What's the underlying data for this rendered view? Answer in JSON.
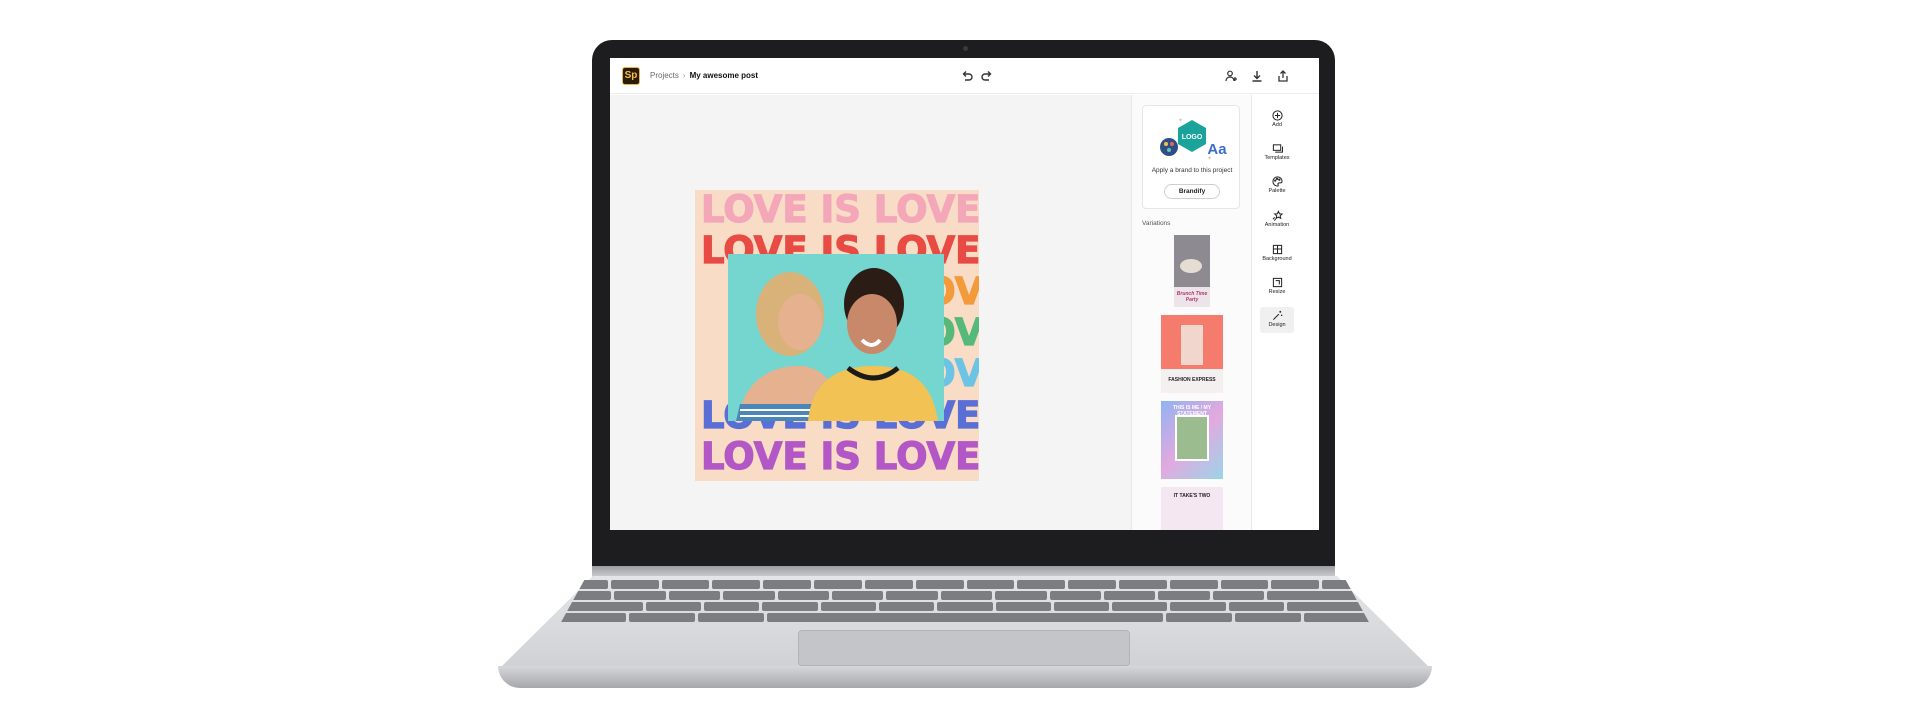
{
  "app": {
    "logo_text": "Sp",
    "breadcrumb": {
      "root": "Projects",
      "separator": "›",
      "current": "My awesome post"
    },
    "accent": "#f6c04b"
  },
  "header_icons": [
    "undo-icon",
    "redo-icon",
    "invite-user-icon",
    "download-icon",
    "share-icon"
  ],
  "poster": {
    "lines": [
      "LOVE IS LOVE",
      "LOVE IS LOVE",
      "LOVE",
      "LOVE",
      "LOVE",
      "LOVE IS LOVE",
      "LOVE IS LOVE"
    ],
    "line_colors": [
      "#f3a7b8",
      "#e84b43",
      "#f39a3b",
      "#54b97a",
      "#6cc4e4",
      "#5a6fd6",
      "#b357c6"
    ],
    "background": "#f8dcc6",
    "photo_background": "#74d6cf"
  },
  "brand_panel": {
    "logo_badge": "LOGO",
    "type_sample": "Aa",
    "prompt": "Apply a brand to this project",
    "button": "Brandify",
    "variations_label": "Variations",
    "variation_texts": [
      "Brunch Time Party",
      "FASHION EXPRESS",
      "THIS IS ME / MY STATEMENT",
      "IT TAKE'S TWO"
    ]
  },
  "toolbar": {
    "items": [
      {
        "label": "Add",
        "icon": "plus-circle-icon"
      },
      {
        "label": "Templates",
        "icon": "templates-icon"
      },
      {
        "label": "Palette",
        "icon": "palette-icon"
      },
      {
        "label": "Animation",
        "icon": "animation-icon"
      },
      {
        "label": "Background",
        "icon": "background-icon"
      },
      {
        "label": "Resize",
        "icon": "resize-icon"
      },
      {
        "label": "Design",
        "icon": "magic-wand-icon"
      }
    ],
    "active": "Design"
  }
}
